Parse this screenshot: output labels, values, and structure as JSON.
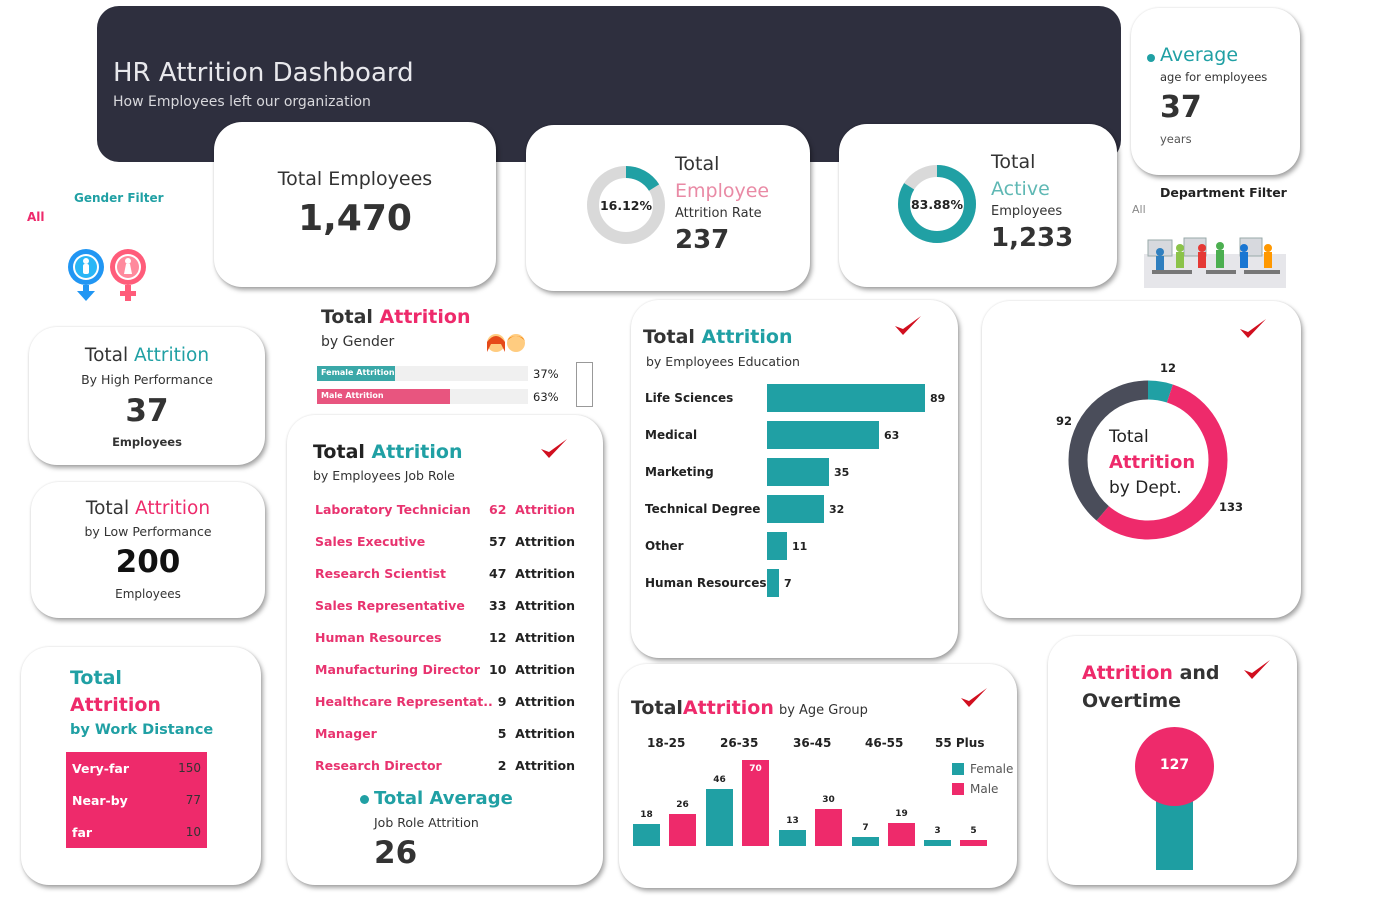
{
  "header": {
    "title": "HR Attrition Dashboard",
    "subtitle": "How Employees left our organization"
  },
  "kpi_total_employees": {
    "label": "Total Employees",
    "value": "1,470"
  },
  "kpi_attrition_rate": {
    "line1": "Total",
    "line2": "Employee",
    "line3": "Attrition Rate",
    "value": "237",
    "percent": "16.12%",
    "fraction": 0.1612
  },
  "kpi_active": {
    "line1": "Total",
    "line2": "Active",
    "line3": "Employees",
    "value": "1,233",
    "percent": "83.88%",
    "fraction": 0.8388
  },
  "kpi_average_age": {
    "title": "Average",
    "subtitle": "age for employees",
    "value": "37",
    "unit": "years"
  },
  "filters": {
    "gender_label": "Gender Filter",
    "gender_value": "All",
    "department_label": "Department Filter",
    "department_value": "All"
  },
  "high_performance": {
    "t1": "Total",
    "t2": "Attrition",
    "sub": "By High Performance",
    "value": "37",
    "unit": "Employees"
  },
  "low_performance": {
    "t1": "Total",
    "t2": "Attrition",
    "sub": "by Low Performance",
    "value": "200",
    "unit": "Employees"
  },
  "work_distance": {
    "t1": "Total",
    "t2": "Attrition",
    "t3": "by Work Distance",
    "rows": [
      {
        "label": "Very-far",
        "value": "150"
      },
      {
        "label": "Near-by",
        "value": "77"
      },
      {
        "label": "far",
        "value": "10"
      }
    ]
  },
  "gender_attrition": {
    "t1": "Total",
    "t2": "Attrition",
    "sub": "by Gender",
    "rows": [
      {
        "label": "Female Attrition",
        "percent": "37%",
        "fraction": 0.37,
        "color": "#3aa8a8"
      },
      {
        "label": "Male Attrition",
        "percent": "63%",
        "fraction": 0.63,
        "color": "#e8557f"
      }
    ]
  },
  "job_role": {
    "t1": "Total",
    "t2": "Attrition",
    "sub": "by Employees Job Role",
    "word": "Attrition",
    "rows": [
      {
        "role": "Laboratory Technician",
        "count": "62"
      },
      {
        "role": "Sales Executive",
        "count": "57"
      },
      {
        "role": "Research Scientist",
        "count": "47"
      },
      {
        "role": "Sales Representative",
        "count": "33"
      },
      {
        "role": "Human Resources",
        "count": "12"
      },
      {
        "role": "Manufacturing Director",
        "count": "10"
      },
      {
        "role": "Healthcare Representat..",
        "count": "9"
      },
      {
        "role": "Manager",
        "count": "5"
      },
      {
        "role": "Research Director",
        "count": "2"
      }
    ],
    "avg_title": "Total Average",
    "avg_sub": "Job Role Attrition",
    "avg_value": "26"
  },
  "education": {
    "t1": "Total",
    "t2": "Attrition",
    "sub": "by Employees Education",
    "max": 89,
    "rows": [
      {
        "label": "Life Sciences",
        "value": 89
      },
      {
        "label": "Medical",
        "value": 63
      },
      {
        "label": "Marketing",
        "value": 35
      },
      {
        "label": "Technical Degree",
        "value": 32
      },
      {
        "label": "Other",
        "value": 11
      },
      {
        "label": "Human Resources",
        "value": 7
      }
    ]
  },
  "department": {
    "l1": "Total",
    "l2": "Attrition",
    "l3": "by Dept.",
    "segments": [
      {
        "value": 12,
        "color": "#20a0a4"
      },
      {
        "value": 133,
        "color": "#ee2a6b"
      },
      {
        "value": 92,
        "color": "#4a4d5a"
      }
    ]
  },
  "age_group": {
    "t1": "Total",
    "t2": "Attrition",
    "sub": "by Age Group",
    "groups": [
      "18-25",
      "26-35",
      "36-45",
      "46-55",
      "55 Plus"
    ],
    "series": [
      {
        "name": "Female",
        "color": "#20a0a4",
        "values": [
          18,
          46,
          13,
          7,
          3
        ]
      },
      {
        "name": "Male",
        "color": "#ee2a6b",
        "values": [
          26,
          70,
          30,
          19,
          5
        ]
      }
    ],
    "max": 70
  },
  "overtime": {
    "t1": "Attrition",
    "t2": "and",
    "t3": "Overtime",
    "value": "127"
  },
  "colors": {
    "teal": "#20a0a4",
    "pink": "#ee2a6b",
    "dark": "#2e2f3e"
  }
}
